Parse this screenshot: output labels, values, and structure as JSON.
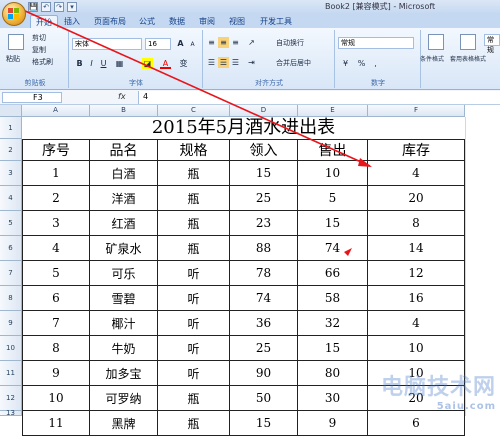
{
  "window": {
    "title": "Book2 [兼容模式] - Microsoft"
  },
  "colors": {
    "accent": "#15428b",
    "annotation": "#e8141a"
  },
  "quick_access": [
    "💾",
    "↶",
    "↷",
    "▾"
  ],
  "tabs": [
    "开始",
    "插入",
    "页面布局",
    "公式",
    "数据",
    "审阅",
    "视图",
    "开发工具"
  ],
  "ribbon": {
    "clipboard": {
      "label": "剪贴板",
      "paste": "粘贴",
      "cut": "剪切",
      "copy": "复制",
      "format_painter": "格式刷"
    },
    "font": {
      "label": "字体",
      "font_name": "宋体",
      "font_size": "16",
      "bold": "B",
      "italic": "I",
      "underline": "U",
      "grow": "A",
      "shrink": "A",
      "font_color": "A",
      "wen": "变"
    },
    "alignment": {
      "label": "对齐方式",
      "wrap": "自动换行",
      "merge": "合并后居中"
    },
    "number": {
      "label": "数字",
      "format": "常规",
      "percent": "%",
      "comma": ","
    },
    "styles": {
      "conditional": "条件格式",
      "table": "套用表格格式",
      "cell_style": "常规"
    }
  },
  "formula_bar": {
    "cell_ref": "F3",
    "fx": "fx",
    "value": "4"
  },
  "columns": [
    "A",
    "B",
    "C",
    "D",
    "E",
    "F"
  ],
  "sheet": {
    "title": "2015年5月酒水进出表",
    "headers": [
      "序号",
      "品名",
      "规格",
      "领入",
      "售出",
      "库存"
    ],
    "rows": [
      [
        "1",
        "白酒",
        "瓶",
        "15",
        "10",
        "4"
      ],
      [
        "2",
        "洋酒",
        "瓶",
        "25",
        "5",
        "20"
      ],
      [
        "3",
        "红酒",
        "瓶",
        "23",
        "15",
        "8"
      ],
      [
        "4",
        "矿泉水",
        "瓶",
        "88",
        "74",
        "14"
      ],
      [
        "5",
        "可乐",
        "听",
        "78",
        "66",
        "12"
      ],
      [
        "6",
        "雪碧",
        "听",
        "74",
        "58",
        "16"
      ],
      [
        "7",
        "椰汁",
        "听",
        "36",
        "32",
        "4"
      ],
      [
        "8",
        "牛奶",
        "听",
        "25",
        "15",
        "10"
      ],
      [
        "9",
        "加多宝",
        "听",
        "90",
        "80",
        "10"
      ],
      [
        "10",
        "可罗纳",
        "瓶",
        "50",
        "30",
        "20"
      ],
      [
        "11",
        "黑牌",
        "瓶",
        "15",
        "9",
        "6"
      ]
    ]
  },
  "row_numbers": [
    "1",
    "2",
    "3",
    "4",
    "5",
    "6",
    "7",
    "8",
    "9",
    "10",
    "11",
    "12",
    "13"
  ],
  "watermark": {
    "main": "电脑技术网",
    "sub": "5aiu.com"
  }
}
